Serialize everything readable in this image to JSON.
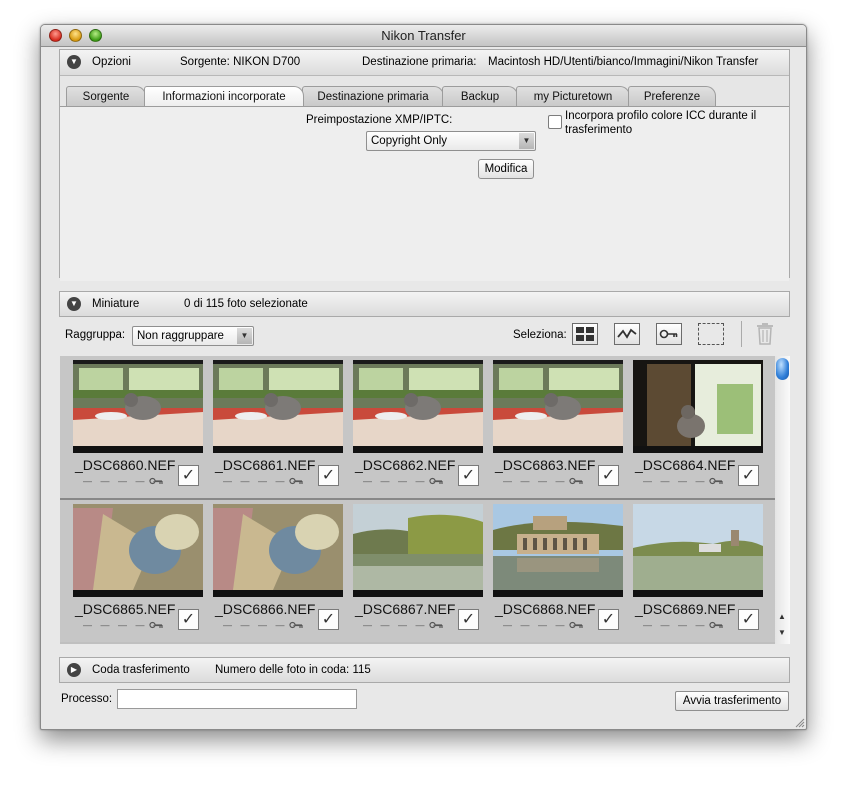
{
  "window": {
    "title": "Nikon Transfer"
  },
  "options": {
    "header": "Opzioni",
    "source": "Sorgente: NIKON D700",
    "destination_label": "Destinazione primaria:",
    "destination_path": "Macintosh HD/Utenti/bianco/Immagini/Nikon Transfer",
    "tabs": [
      "Sorgente",
      "Informazioni incorporate",
      "Destinazione primaria",
      "Backup",
      "my Picturetown",
      "Preferenze"
    ],
    "active_tab": "Informazioni incorporate",
    "preset_label": "Preimpostazione XMP/IPTC:",
    "preset_value": "Copyright Only",
    "modify_button": "Modifica",
    "icc_line1": "Incorpora profilo colore ICC durante il",
    "icc_line2": "trasferimento"
  },
  "thumbnails_section": {
    "header": "Miniature",
    "selected_count": "0 di 115 foto selezionate",
    "group_label": "Raggruppa:",
    "group_value": "Non raggruppare",
    "select_label": "Seleziona:",
    "select_icons": [
      "select-all-icon",
      "select-range-icon",
      "select-protected-icon",
      "deselect-icon"
    ],
    "delete_icon": "trash-icon",
    "files": [
      {
        "name": "_DSC6860.NEF",
        "scene": "cat",
        "checked": true
      },
      {
        "name": "_DSC6861.NEF",
        "scene": "cat",
        "checked": true
      },
      {
        "name": "_DSC6862.NEF",
        "scene": "cat",
        "checked": true
      },
      {
        "name": "_DSC6863.NEF",
        "scene": "cat",
        "checked": true
      },
      {
        "name": "_DSC6864.NEF",
        "scene": "cat-window",
        "checked": true
      },
      {
        "name": "_DSC6865.NEF",
        "scene": "blur",
        "checked": true
      },
      {
        "name": "_DSC6866.NEF",
        "scene": "blur",
        "checked": true
      },
      {
        "name": "_DSC6867.NEF",
        "scene": "lake",
        "checked": true
      },
      {
        "name": "_DSC6868.NEF",
        "scene": "ruins",
        "checked": true
      },
      {
        "name": "_DSC6869.NEF",
        "scene": "lake2",
        "checked": true
      }
    ]
  },
  "queue": {
    "header": "Coda trasferimento",
    "count": "Numero delle foto in coda: 115"
  },
  "process": {
    "label": "Processo:",
    "value": "",
    "start_button": "Avvia trasferimento"
  }
}
